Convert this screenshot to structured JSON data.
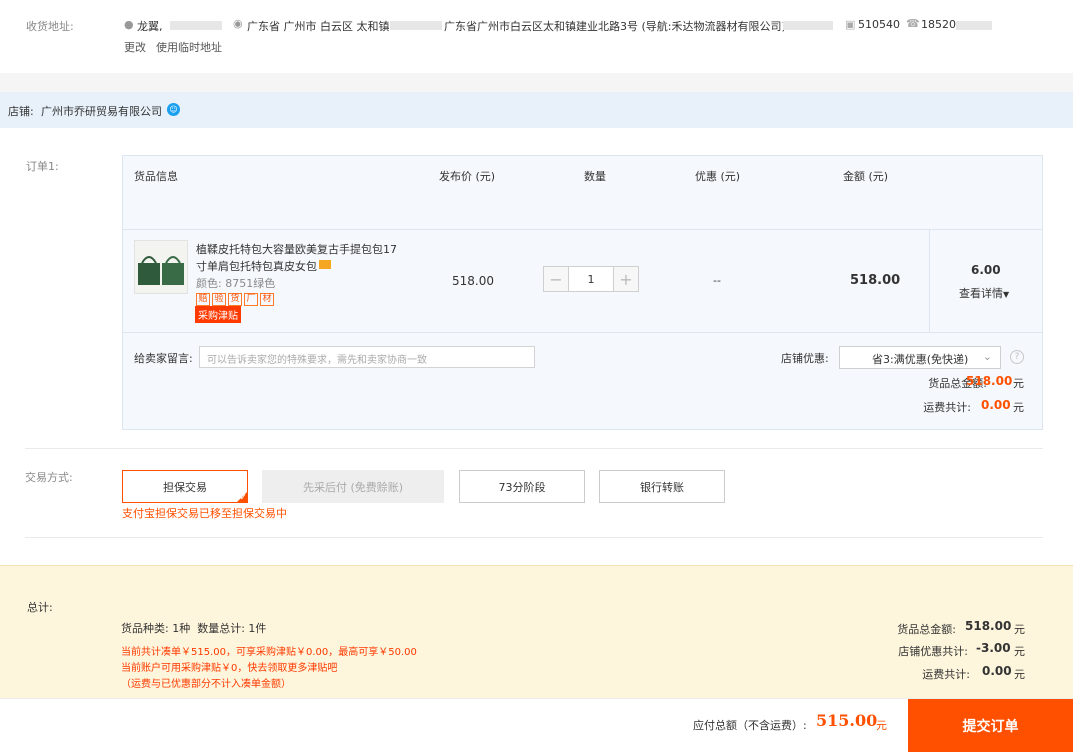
{
  "address": {
    "label": "收货地址:",
    "name": "龙翼,",
    "region": "广东省 广州市 白云区 太和镇",
    "detail": "广东省广州市白云区太和镇建业北路3号 (导航:禾达物流器材有限公司)",
    "postcode": "510540",
    "phone": "18520",
    "change_link": "更改",
    "temp_link": "使用临时地址"
  },
  "shop": {
    "label": "店铺:",
    "name": "广州市乔研贸易有限公司"
  },
  "order": {
    "label": "订单1:",
    "headers": {
      "goods": "货品信息",
      "price": "发布价 (元)",
      "qty": "数量",
      "discount": "优惠 (元)",
      "amount": "金额 (元)"
    },
    "item": {
      "title_line1": "植鞣皮托特包大容量欧美复古手提包包17",
      "title_line2": "寸单肩包托特包真皮女包",
      "spec": "颜色: 8751绿色",
      "tags": [
        "赔",
        "验",
        "货",
        "厂",
        "材"
      ],
      "subsidy": "采购津贴",
      "price": "518.00",
      "qty": "1",
      "minus": "−",
      "plus": "+",
      "discount": "--",
      "amount": "518.00",
      "freight": "6.00",
      "detail_link": "查看详情"
    },
    "message_label": "给卖家留言:",
    "message_placeholder": "可以告诉卖家您的特殊要求，需先和卖家协商一致",
    "shop_discount_label": "店铺优惠:",
    "shop_discount_value": "省3:满优惠(免快递)",
    "goods_total_label": "货品总金额:",
    "goods_total_value": "518.00",
    "freight_total_label": "运费共计:",
    "freight_total_value": "0.00",
    "currency": "元"
  },
  "trade": {
    "label": "交易方式:",
    "options": [
      "担保交易",
      "先采后付 (免费赊账)",
      "73分阶段",
      "银行转账"
    ],
    "note": "支付宝担保交易已移至担保交易中"
  },
  "summary": {
    "label": "总计:",
    "counts": "货品种类: 1种  数量总计: 1件",
    "notice1": "当前共计凑单￥515.00，可享采购津贴￥0.00，最高可享￥50.00",
    "notice2": "当前账户可用采购津贴￥0，快去领取更多津贴吧",
    "notice3": "（运费与已优惠部分不计入凑单金额）",
    "goods_total_label": "货品总金额:",
    "goods_total_value": "518.00",
    "shop_discount_label": "店铺优惠共计:",
    "shop_discount_value": "-3.00",
    "freight_label": "运费共计:",
    "freight_value": "0.00",
    "currency": "元"
  },
  "footer": {
    "pay_label": "应付总额（不含运费）:",
    "pay_value": "515.00",
    "currency": "元",
    "submit": "提交订单"
  },
  "colors": {
    "accent": "#ff5000",
    "shop_bar": "#e8f1fa",
    "summary_bg": "#fdf5dc"
  }
}
